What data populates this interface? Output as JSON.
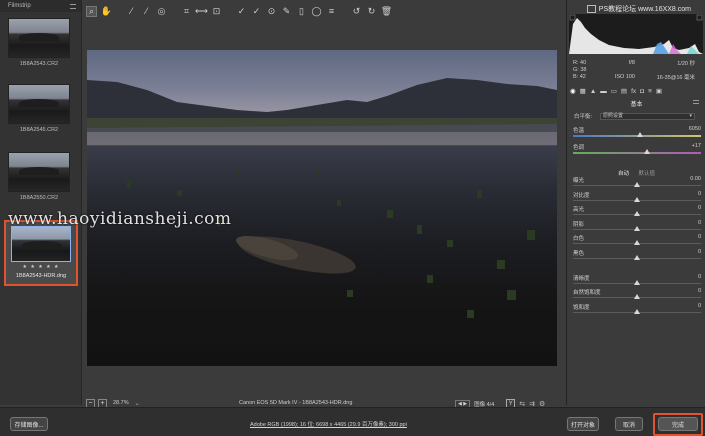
{
  "filmstrip": {
    "title": "Filmstrip",
    "items": [
      {
        "label": "1B8A2543.CR2"
      },
      {
        "label": "1B8A2545.CR2"
      },
      {
        "label": "1B8A2550.CR2"
      },
      {
        "label": "1B8A2543-HDR.dng",
        "selected": true,
        "stars": "★ ★ ★ ★ ★"
      }
    ]
  },
  "watermark": "www.haoyidiansheji.com",
  "rpanel": {
    "title": "PS教程论坛 www.16XX8.com",
    "exif": [
      {
        "c1": "R: 40",
        "c2": "f/8",
        "c3": "1/20 秒"
      },
      {
        "c1": "G: 38",
        "c2": "",
        "c3": ""
      },
      {
        "c1": "B: 42",
        "c2": "ISO 100",
        "c3": "16-35@16 毫米"
      }
    ],
    "section_title": "基本",
    "wb_label": "白平衡:",
    "wb_value": "原照设置",
    "temp": {
      "label": "色温",
      "value": "6050",
      "pos": 0.52
    },
    "tint": {
      "label": "色调",
      "value": "+17",
      "pos": 0.58
    },
    "auto_label": "自动",
    "default_label": "默认值",
    "sliders": [
      {
        "label": "曝光",
        "value": "0.00",
        "pos": 0.5
      },
      {
        "label": "对比度",
        "value": "0",
        "pos": 0.5
      },
      {
        "label": "高光",
        "value": "0",
        "pos": 0.5
      },
      {
        "label": "阴影",
        "value": "0",
        "pos": 0.5
      },
      {
        "label": "白色",
        "value": "0",
        "pos": 0.5
      },
      {
        "label": "黑色",
        "value": "0",
        "pos": 0.5
      },
      {
        "label": "清晰度",
        "value": "0",
        "pos": 0.5
      },
      {
        "label": "自然饱和度",
        "value": "0",
        "pos": 0.5
      },
      {
        "label": "饱和度",
        "value": "0",
        "pos": 0.5
      }
    ]
  },
  "status": {
    "zoom_minus": "−",
    "zoom_plus": "+",
    "zoom": "28.7%",
    "camera": "Canon EOS 5D Mark IV - 1B8A2543-HDR.dng",
    "nav_arrows": "◀ ▶",
    "image_count": "图像 4/4",
    "y_label": "Y"
  },
  "bottom": {
    "save": "存储图像...",
    "info": "Adobe RGB (1998); 16 位; 6698 x 4465 (29.9 百万像素); 300 ppi",
    "open": "打开对象",
    "cancel": "取消",
    "done": "完成"
  },
  "colors": {
    "highlight": "#e0532e",
    "panel": "#3b3b3b",
    "selection_border": "#8fb3e8"
  }
}
